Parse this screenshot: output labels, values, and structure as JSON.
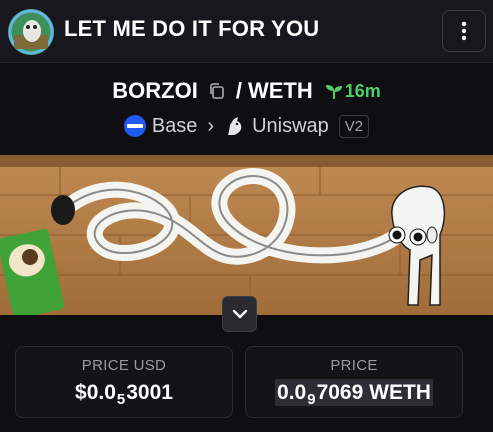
{
  "header": {
    "token_name": "LET ME DO IT FOR YOU"
  },
  "pair": {
    "base_symbol": "BORZOI",
    "separator": "/",
    "quote_symbol": "WETH",
    "age": "16m"
  },
  "chain": {
    "network": "Base",
    "dex": "Uniswap",
    "version": "V2"
  },
  "prices": {
    "usd_label": "PRICE USD",
    "usd_prefix": "$0.0",
    "usd_zeros": "5",
    "usd_digits": "3001",
    "native_label": "PRICE",
    "native_prefix": "0.0",
    "native_zeros": "9",
    "native_digits": "7069 WETH"
  },
  "colors": {
    "age_green": "#4ecf69",
    "base_blue": "#1f5bf0",
    "background": "#0f0f13"
  }
}
